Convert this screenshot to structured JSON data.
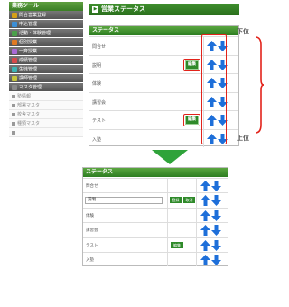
{
  "sidebar": {
    "title": "業務ツール",
    "items": [
      {
        "label": "問合営業登録",
        "color": "#d4a017",
        "sub": false
      },
      {
        "label": "申込管理",
        "color": "#3c8fd6",
        "sub": false
      },
      {
        "label": "活動・体験管理",
        "color": "#4aa04a",
        "sub": false
      },
      {
        "label": "個別授業",
        "color": "#e07b24",
        "sub": false
      },
      {
        "label": "一斉授業",
        "color": "#a86ad6",
        "sub": false
      },
      {
        "label": "成績管理",
        "color": "#d64a4a",
        "sub": false
      },
      {
        "label": "生徒管理",
        "color": "#3cb4b4",
        "sub": false
      },
      {
        "label": "講師管理",
        "color": "#c4c43c",
        "sub": false
      },
      {
        "label": "マスタ管理",
        "color": "#888888",
        "sub": false
      },
      {
        "label": "塾情報",
        "color": "#999999",
        "sub": true
      },
      {
        "label": "部署マスタ",
        "color": "#999999",
        "sub": true
      },
      {
        "label": "校舎マスタ",
        "color": "#999999",
        "sub": true
      },
      {
        "label": "種類マスタ",
        "color": "#999999",
        "sub": true
      },
      {
        "label": "",
        "color": "#999999",
        "sub": true
      }
    ]
  },
  "header": {
    "title": "営業ステータス",
    "arrow": "▶"
  },
  "panel": {
    "title": "ステータス",
    "rows": [
      {
        "label": "問合せ",
        "edit": false
      },
      {
        "label": "説明",
        "edit": true
      },
      {
        "label": "体験",
        "edit": false
      },
      {
        "label": "講習会",
        "edit": false
      },
      {
        "label": "テスト",
        "edit": true
      },
      {
        "label": "入塾",
        "edit": false
      }
    ],
    "edit_label": "編集",
    "side_top": "下位",
    "side_bottom": "上位"
  },
  "panel2": {
    "title": "ステータス",
    "rows": [
      {
        "label": "問合せ"
      },
      {
        "label": "説明",
        "input": "説明",
        "save": "登録",
        "cancel": "取消"
      },
      {
        "label": "体験"
      },
      {
        "label": "講習会"
      },
      {
        "label": "テスト",
        "edit": "編集"
      },
      {
        "label": "入塾"
      }
    ]
  },
  "colors": {
    "green": "#2f8a2a",
    "arrow_blue": "#1e6fd9",
    "red": "#e2231a"
  }
}
